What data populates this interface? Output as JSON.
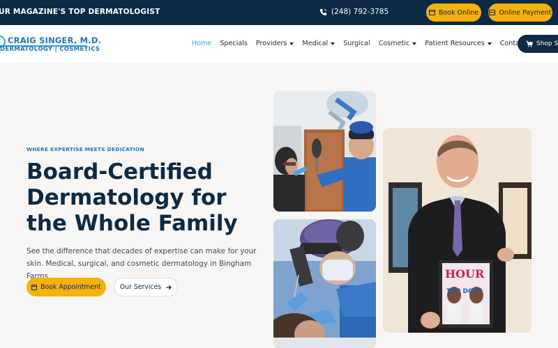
{
  "topbar": {
    "promo": "UR MAGAZINE'S TOP DERMATOLOGIST",
    "phone": "(248) 792-3785",
    "book_online": "Book Online",
    "online_payment": "Online Payment"
  },
  "logo": {
    "name": "CRAIG SINGER, M.D.",
    "sub": "DERMATOLOGY | COSMETICS"
  },
  "nav": {
    "items": [
      {
        "label": "Home",
        "active": true
      },
      {
        "label": "Specials"
      },
      {
        "label": "Providers",
        "dropdown": true
      },
      {
        "label": "Medical",
        "dropdown": true
      },
      {
        "label": "Surgical"
      },
      {
        "label": "Cosmetic",
        "dropdown": true
      },
      {
        "label": "Patient Resources",
        "dropdown": true
      },
      {
        "label": "Contact"
      }
    ],
    "shop_label": "Shop Skin"
  },
  "hero": {
    "tagline": "WHERE EXPERTISE MEETS DEDICATION",
    "headline": "Board-Certified Dermatology for the Whole Family",
    "description": "See the difference that decades of expertise can make for your skin. Medical, surgical, and cosmetic dermatology in Bingham Farms.",
    "primary_cta": "Book Appointment",
    "secondary_cta": "Our Services"
  },
  "photos": {
    "magazine_title": "HOUR",
    "magazine_banner": "TOP DOCS"
  },
  "colors": {
    "navy": "#0c2a44",
    "accent_yellow": "#f6b10f",
    "brand_blue": "#1f74b8",
    "link_active": "#2ea7de"
  }
}
